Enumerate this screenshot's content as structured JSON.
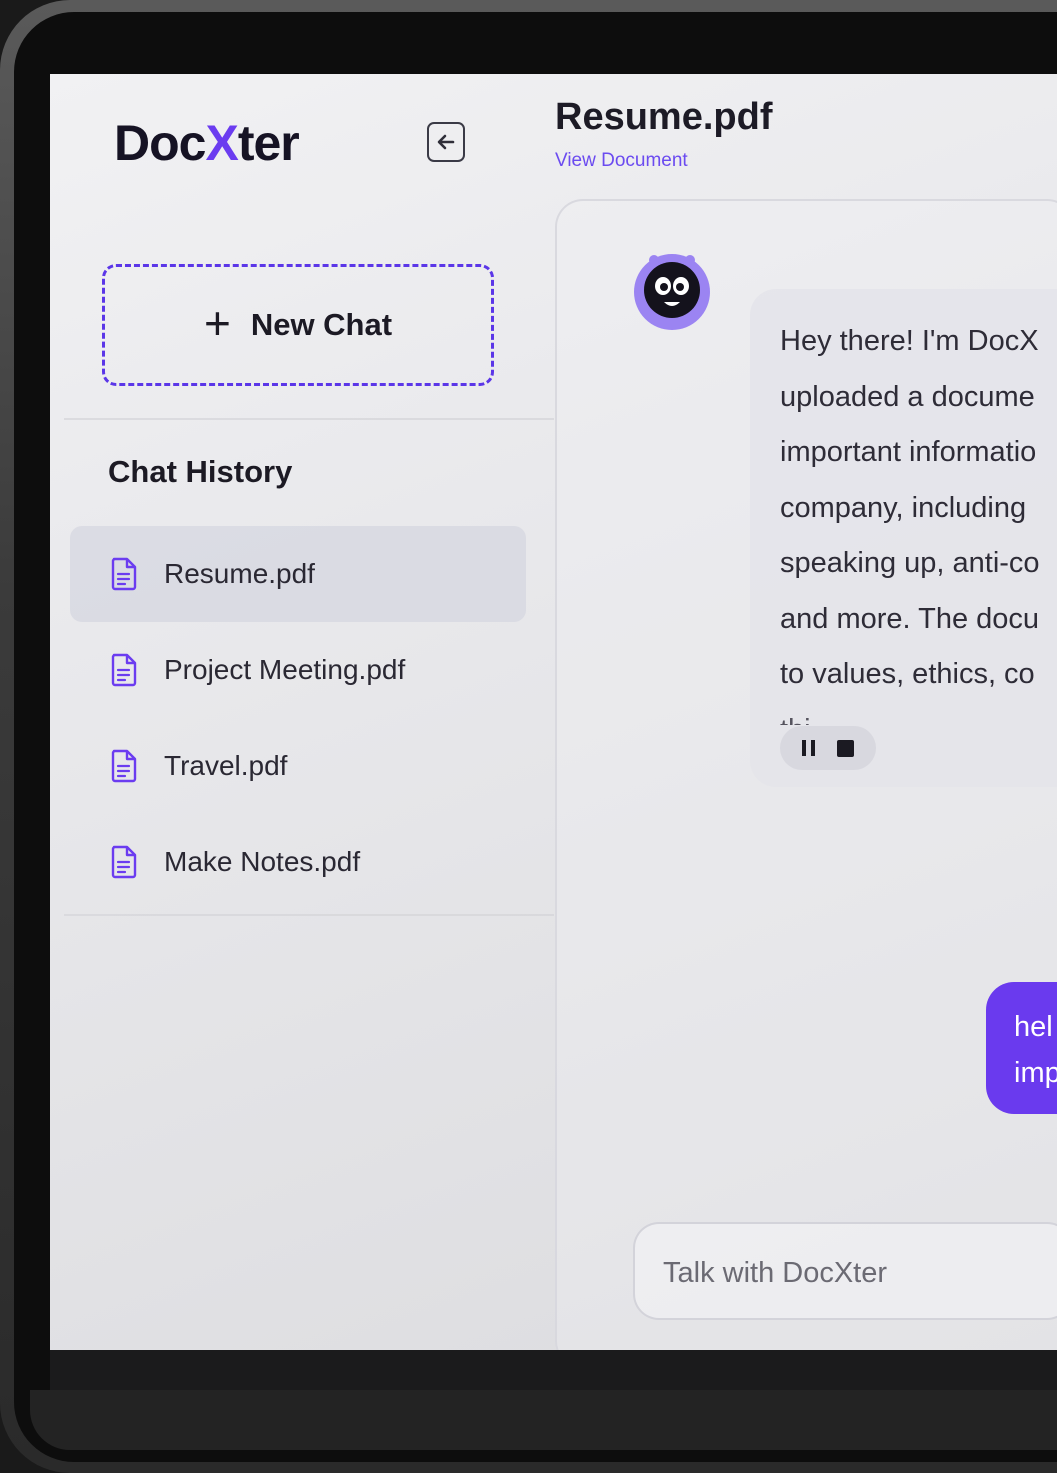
{
  "app": {
    "logo_prefix": "Doc",
    "logo_x": "X",
    "logo_suffix": "ter"
  },
  "sidebar": {
    "new_chat_label": "New Chat",
    "history_title": "Chat History",
    "items": [
      {
        "label": "Resume.pdf",
        "active": true
      },
      {
        "label": "Project Meeting.pdf",
        "active": false
      },
      {
        "label": "Travel.pdf",
        "active": false
      },
      {
        "label": "Make Notes.pdf",
        "active": false
      }
    ]
  },
  "header": {
    "title": "Resume.pdf",
    "view_document": "View Document"
  },
  "chat": {
    "bot_lines": [
      "Hey there! I'm DocX",
      "uploaded a docume",
      "important informatio",
      "company, including",
      "speaking up, anti-co",
      "and more. The docu",
      "to values, ethics, co",
      "thi..."
    ],
    "user_lines": [
      "hel",
      "imp"
    ]
  },
  "input": {
    "placeholder": "Talk with DocXter"
  },
  "colors": {
    "accent": "#6b3cf0",
    "user_bubble": "#6a3aee"
  }
}
